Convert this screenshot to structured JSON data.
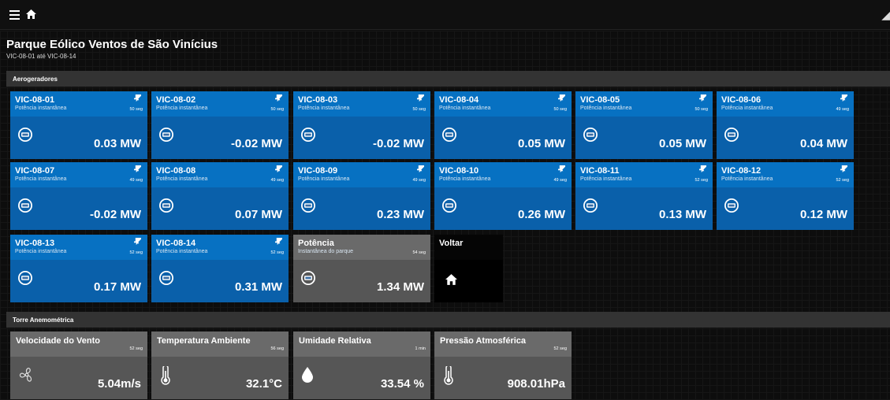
{
  "topbar": {
    "menu_icon": "menu-icon",
    "home_icon": "home-icon"
  },
  "page": {
    "title": "Parque Eólico Ventos de São Vinícius",
    "subtitle": "VIC-08-01 até VIC-08-14"
  },
  "sections": {
    "turbines": "Aerogeradores",
    "tower": "Torre Anemométrica"
  },
  "turbines": [
    {
      "name": "VIC-08-01",
      "desc": "Potência instantânea",
      "age": "50 seg",
      "value": "0.03 MW"
    },
    {
      "name": "VIC-08-02",
      "desc": "Potência instantânea",
      "age": "50 seg",
      "value": "-0.02 MW"
    },
    {
      "name": "VIC-08-03",
      "desc": "Potência instantânea",
      "age": "50 seg",
      "value": "-0.02 MW"
    },
    {
      "name": "VIC-08-04",
      "desc": "Potência instantânea",
      "age": "50 seg",
      "value": "0.05 MW"
    },
    {
      "name": "VIC-08-05",
      "desc": "Potência instantânea",
      "age": "50 seg",
      "value": "0.05 MW"
    },
    {
      "name": "VIC-08-06",
      "desc": "Potência instantânea",
      "age": "49 seg",
      "value": "0.04 MW"
    },
    {
      "name": "VIC-08-07",
      "desc": "Potência instantânea",
      "age": "49 seg",
      "value": "-0.02 MW"
    },
    {
      "name": "VIC-08-08",
      "desc": "Potência instantânea",
      "age": "49 seg",
      "value": "0.07 MW"
    },
    {
      "name": "VIC-08-09",
      "desc": "Potência instantânea",
      "age": "49 seg",
      "value": "0.23 MW"
    },
    {
      "name": "VIC-08-10",
      "desc": "Potência instantânea",
      "age": "49 seg",
      "value": "0.26 MW"
    },
    {
      "name": "VIC-08-11",
      "desc": "Potência instantânea",
      "age": "52 seg",
      "value": "0.13 MW"
    },
    {
      "name": "VIC-08-12",
      "desc": "Potência instantânea",
      "age": "52 seg",
      "value": "0.12 MW"
    },
    {
      "name": "VIC-08-13",
      "desc": "Potência instantânea",
      "age": "52 seg",
      "value": "0.17 MW"
    },
    {
      "name": "VIC-08-14",
      "desc": "Potência instantânea",
      "age": "52 seg",
      "value": "0.31 MW"
    }
  ],
  "park_power": {
    "name": "Potência",
    "desc": "Instantânea do parque",
    "age": "54 seg",
    "value": "1.34 MW"
  },
  "back_tile": {
    "label": "Voltar",
    "icon": "home-icon"
  },
  "tower": [
    {
      "name": "Velocidade do Vento",
      "age": "52 seg",
      "value": "5.04m/s",
      "icon": "fan-icon"
    },
    {
      "name": "Temperatura Ambiente",
      "age": "56 seg",
      "value": "32.1°C",
      "icon": "thermometer-icon"
    },
    {
      "name": "Umidade Relativa",
      "age": "1 min",
      "value": "33.54 %",
      "icon": "water-drop-icon"
    },
    {
      "name": "Pressão Atmosférica",
      "age": "52 seg",
      "value": "908.01hPa",
      "icon": "thermometer-icon"
    }
  ],
  "colors": {
    "tile_blue": "#0771c2",
    "tile_blue_body": "#0a60aa",
    "tile_grey": "#6a6a6a",
    "section_bar": "#333333"
  }
}
